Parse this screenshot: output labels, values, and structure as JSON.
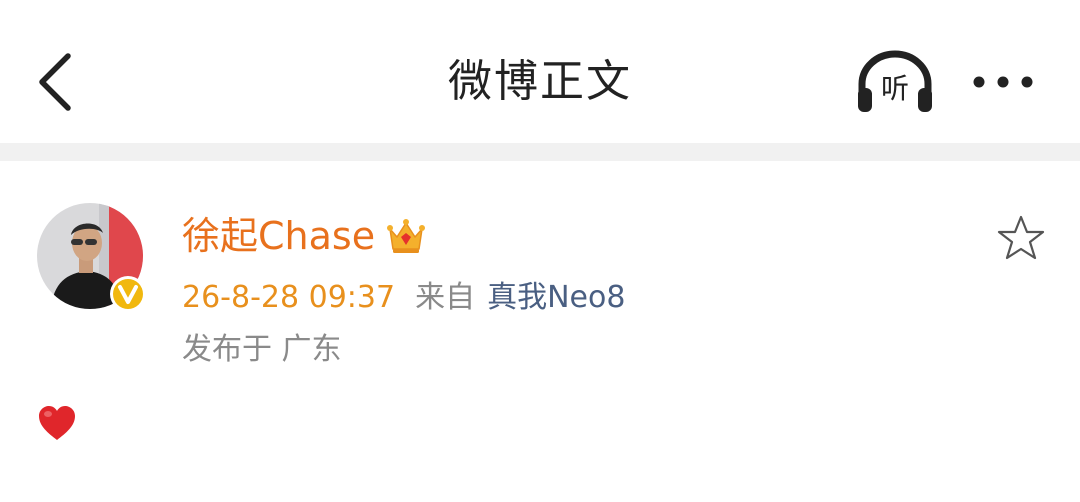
{
  "header": {
    "title": "微博正文",
    "listen_label": "听",
    "icons": {
      "back": "chevron-left-icon",
      "listen": "headphones-icon",
      "more": "more-dots-icon"
    }
  },
  "post": {
    "author": {
      "name": "徐起Chase",
      "verified": true,
      "badge_icon": "verified-v-icon",
      "member_icon": "crown-icon"
    },
    "time": "26-8-28 09:37",
    "source_prefix": "来自",
    "source_device": "真我Neo8",
    "location": "发布于 广东",
    "content_icon": "red-heart-icon"
  },
  "colors": {
    "name": "#e8711d",
    "time": "#e8901d",
    "device": "#4a5f82",
    "muted": "#8a8a8a",
    "divider": "#f1f1f1",
    "heart": "#e0262b"
  }
}
